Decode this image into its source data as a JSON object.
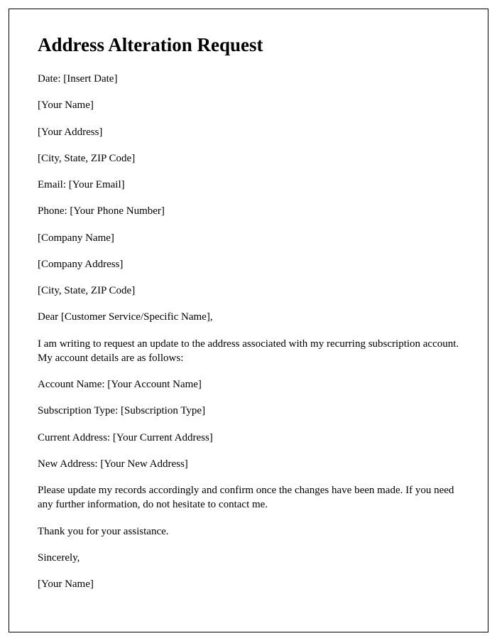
{
  "title": "Address Alteration Request",
  "lines": {
    "date": "Date: [Insert Date]",
    "yourName": "[Your Name]",
    "yourAddress": "[Your Address]",
    "yourCityStateZip": "[City, State, ZIP Code]",
    "email": "Email: [Your Email]",
    "phone": "Phone: [Your Phone Number]",
    "companyName": "[Company Name]",
    "companyAddress": "[Company Address]",
    "companyCityStateZip": "[City, State, ZIP Code]",
    "salutation": "Dear [Customer Service/Specific Name],",
    "intro": "I am writing to request an update to the address associated with my recurring subscription account. My account details are as follows:",
    "accountName": "Account Name: [Your Account Name]",
    "subscriptionType": "Subscription Type: [Subscription Type]",
    "currentAddress": "Current Address: [Your Current Address]",
    "newAddress": "New Address: [Your New Address]",
    "request": "Please update my records accordingly and confirm once the changes have been made. If you need any further information, do not hesitate to contact me.",
    "thanks": "Thank you for your assistance.",
    "closing": "Sincerely,",
    "signature": "[Your Name]"
  }
}
